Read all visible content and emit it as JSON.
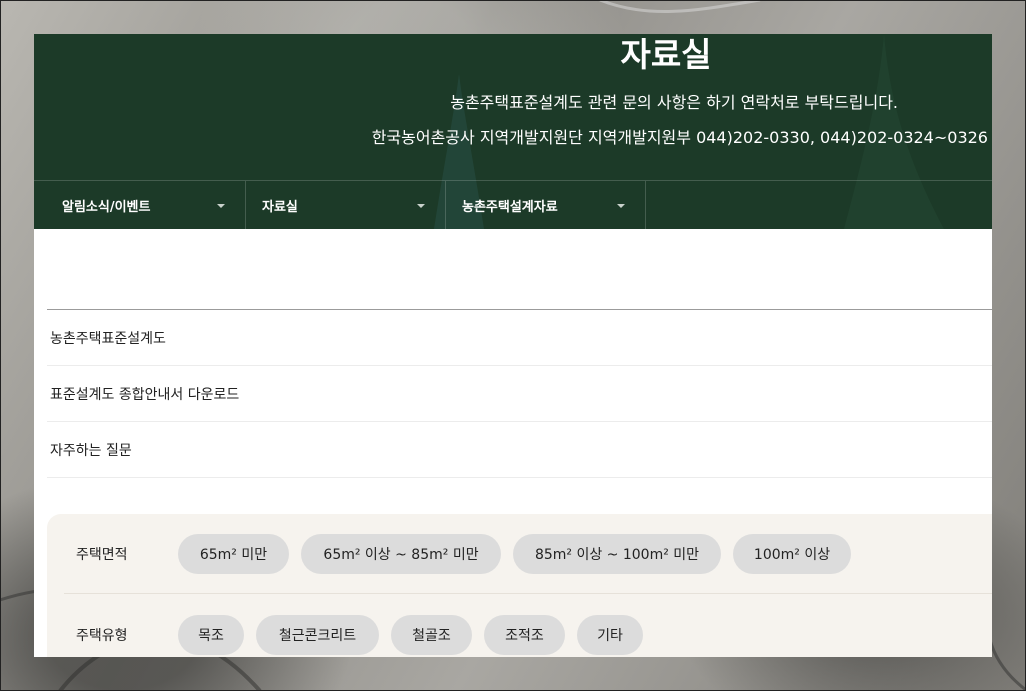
{
  "hero": {
    "title": "자료실",
    "description_line1": "농촌주택표준설계도 관련 문의 사항은 하기 연락처로 부탁드립니다.",
    "description_line2": "한국농어촌공사 지역개발지원단 지역개발지원부 044)202-0330, 044)202-0324~0326"
  },
  "nav": {
    "items": [
      {
        "label": "알림소식/이벤트"
      },
      {
        "label": "자료실"
      },
      {
        "label": "농촌주택설계자료"
      }
    ]
  },
  "menu": {
    "items": [
      {
        "label": "농촌주택표준설계도"
      },
      {
        "label": "표준설계도 종합안내서 다운로드"
      },
      {
        "label": "자주하는 질문"
      }
    ]
  },
  "filters": {
    "area": {
      "label": "주택면적",
      "options": [
        "65m² 미만",
        "65m² 이상 ~ 85m² 미만",
        "85m² 이상 ~ 100m² 미만",
        "100m² 이상"
      ]
    },
    "type": {
      "label": "주택유형",
      "options": [
        "목조",
        "철근콘크리트",
        "철골조",
        "조적조",
        "기타"
      ]
    }
  },
  "colors": {
    "hero_bg": "#1c3a28",
    "chip_bg": "#dcdcdc",
    "filter_bg": "#f6f3ee"
  }
}
